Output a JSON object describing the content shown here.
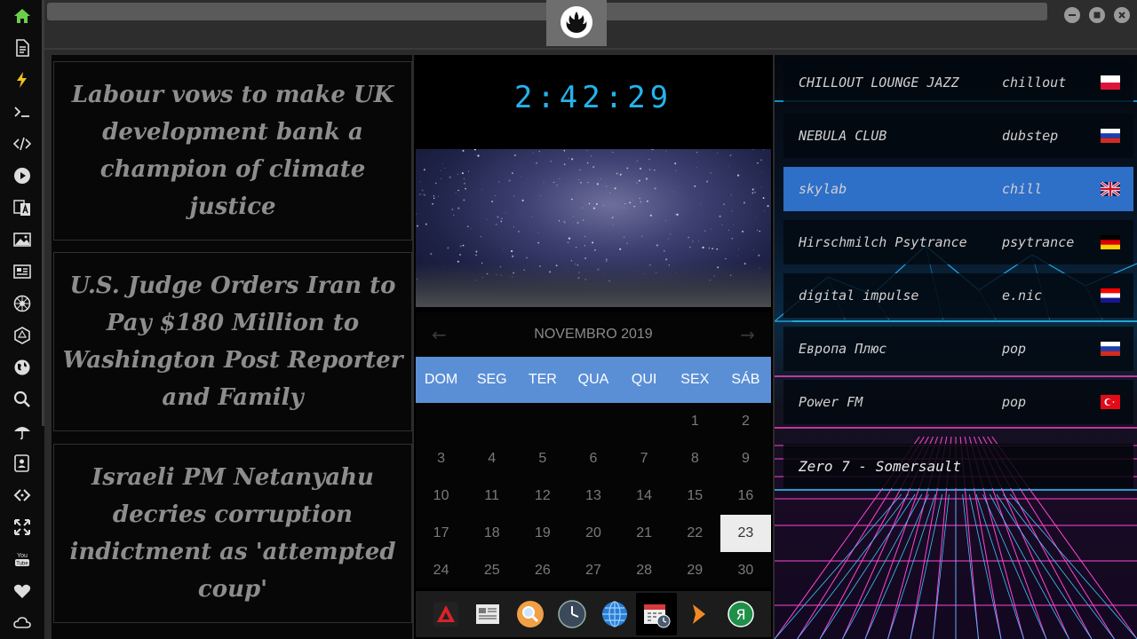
{
  "news": {
    "headlines": [
      "Labour vows to make UK development bank a champion of climate justice",
      "U.S. Judge Orders Iran to Pay $180 Million to Washington Post Reporter and Family",
      "Israeli PM Netanyahu decries corruption indictment as 'attempted coup'"
    ]
  },
  "clock": {
    "time": "2:42:29"
  },
  "calendar": {
    "month": "NOVEMBRO 2019",
    "weekdays": [
      "DOM",
      "SEG",
      "TER",
      "QUA",
      "QUI",
      "SEX",
      "SÁB"
    ],
    "weeks": [
      [
        "",
        "",
        "",
        "",
        "",
        "1",
        "2"
      ],
      [
        "3",
        "4",
        "5",
        "6",
        "7",
        "8",
        "9"
      ],
      [
        "10",
        "11",
        "12",
        "13",
        "14",
        "15",
        "16"
      ],
      [
        "17",
        "18",
        "19",
        "20",
        "21",
        "22",
        "23"
      ],
      [
        "24",
        "25",
        "26",
        "27",
        "28",
        "29",
        "30"
      ]
    ],
    "today": "23"
  },
  "radio": {
    "stations": [
      {
        "name": "CHILLOUT LOUNGE JAZZ",
        "genre": "chillout",
        "flag": "pl"
      },
      {
        "name": "NEBULA CLUB",
        "genre": "dubstep",
        "flag": "ru"
      },
      {
        "name": "skylab",
        "genre": "chill",
        "flag": "gb",
        "selected": true
      },
      {
        "name": "Hirschmilch Psytrance",
        "genre": "psytrance",
        "flag": "de"
      },
      {
        "name": "digital impulse",
        "genre": "e.nic",
        "flag": "hr"
      },
      {
        "name": "Европа Плюс",
        "genre": "pop",
        "flag": "ru"
      },
      {
        "name": "Power FM",
        "genre": "pop",
        "flag": "tr"
      }
    ],
    "now_playing": "Zero 7 - Somersault"
  },
  "sidebar": {
    "icons": [
      "home-icon",
      "document-icon",
      "lightning-icon",
      "terminal-icon",
      "code-icon",
      "play-icon",
      "translate-icon",
      "image-icon",
      "newspaper-icon",
      "rebel-icon",
      "hexagon-icon",
      "globe-icon",
      "search-icon",
      "umbrella-icon",
      "contacts-icon",
      "link-icon",
      "expand-icon",
      "youtube-icon",
      "heart-icon",
      "cloud-icon"
    ]
  },
  "dock": {
    "icons": [
      "app-red-icon",
      "news-app-icon",
      "search-app-icon",
      "clock-app-icon",
      "browser-globe-icon",
      "calendar-app-icon",
      "arrow-app-icon",
      "yandex-icon"
    ]
  },
  "colors": {
    "accent_blue": "#5a8fd6",
    "clock_cyan": "#24b3ec",
    "selected_station": "#2e6fc8",
    "home_green": "#6ccf4a",
    "lightning_yellow": "#f0c419"
  }
}
